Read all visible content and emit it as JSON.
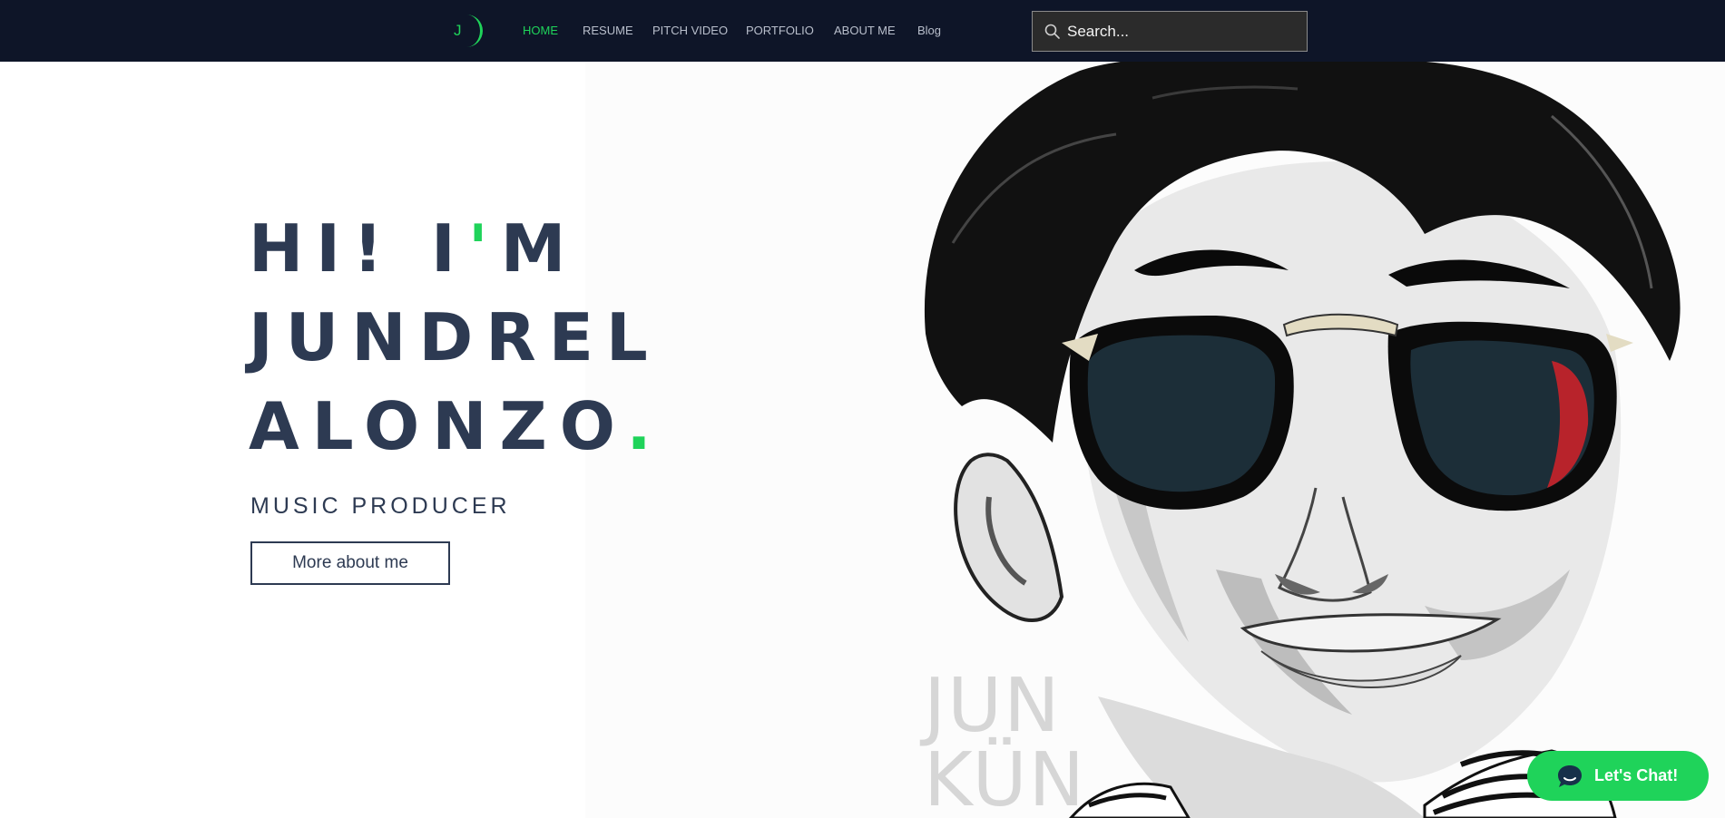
{
  "nav": {
    "logo_letter": "J",
    "items": [
      {
        "label": "HOME",
        "active": true
      },
      {
        "label": "RESUME",
        "active": false
      },
      {
        "label": "PITCH VIDEO",
        "active": false
      },
      {
        "label": "PORTFOLIO",
        "active": false
      },
      {
        "label": "ABOUT ME",
        "active": false
      },
      {
        "label": "Blog",
        "active": false
      }
    ],
    "search_placeholder": "Search..."
  },
  "hero": {
    "line1_a": "HI! I",
    "line1_apostrophe": "'",
    "line1_b": "M",
    "line2": "JUNDREL",
    "line3": "ALONZO",
    "line3_dot": ".",
    "subtitle": "MUSIC PRODUCER",
    "button_label": "More about me",
    "watermark": "JUN\nKÜN"
  },
  "chat": {
    "label": "Let's Chat!"
  },
  "colors": {
    "nav_background": "#0e1528",
    "accent": "#1fd35a",
    "headline": "#2d3a52",
    "search_background": "#2b2b2b"
  },
  "icons": [
    "logo-crescent-icon",
    "search-icon",
    "chat-bubble-icon"
  ]
}
